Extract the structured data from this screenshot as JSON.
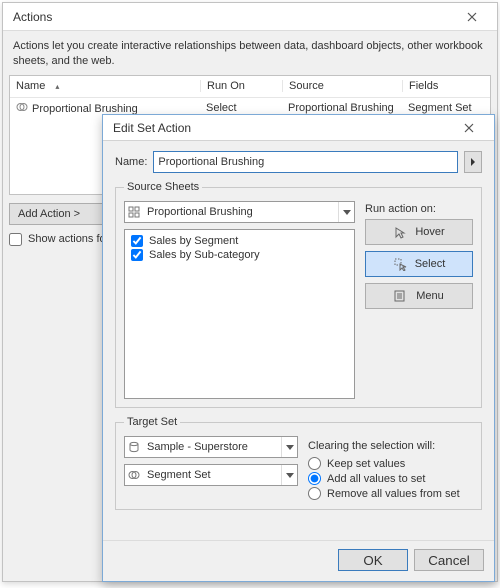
{
  "actions_dialog": {
    "title": "Actions",
    "description": "Actions let you create interactive relationships between data, dashboard objects, other workbook sheets, and the web.",
    "columns": {
      "name": "Name",
      "run_on": "Run On",
      "source": "Source",
      "fields": "Fields"
    },
    "rows": [
      {
        "name": "Proportional Brushing",
        "run_on": "Select",
        "source": "Proportional Brushing",
        "fields": "Segment Set"
      }
    ],
    "add_action_label": "Add Action >",
    "show_actions_label": "Show actions for"
  },
  "edit_dialog": {
    "title": "Edit Set Action",
    "name_label": "Name:",
    "name_value": "Proportional Brushing",
    "source_sheets_legend": "Source Sheets",
    "source_combo": "Proportional Brushing",
    "sheets": [
      {
        "label": "Sales by Segment",
        "checked": true
      },
      {
        "label": "Sales by Sub-category",
        "checked": true
      }
    ],
    "run_action_on": "Run action on:",
    "buttons": {
      "hover": "Hover",
      "select": "Select",
      "menu": "Menu"
    },
    "target_set_legend": "Target Set",
    "target_datasource": "Sample - Superstore",
    "target_set": "Segment Set",
    "clearing_label": "Clearing the selection will:",
    "radios": {
      "keep": "Keep set values",
      "add": "Add all values to set",
      "remove": "Remove all values from set"
    },
    "ok": "OK",
    "cancel": "Cancel"
  }
}
